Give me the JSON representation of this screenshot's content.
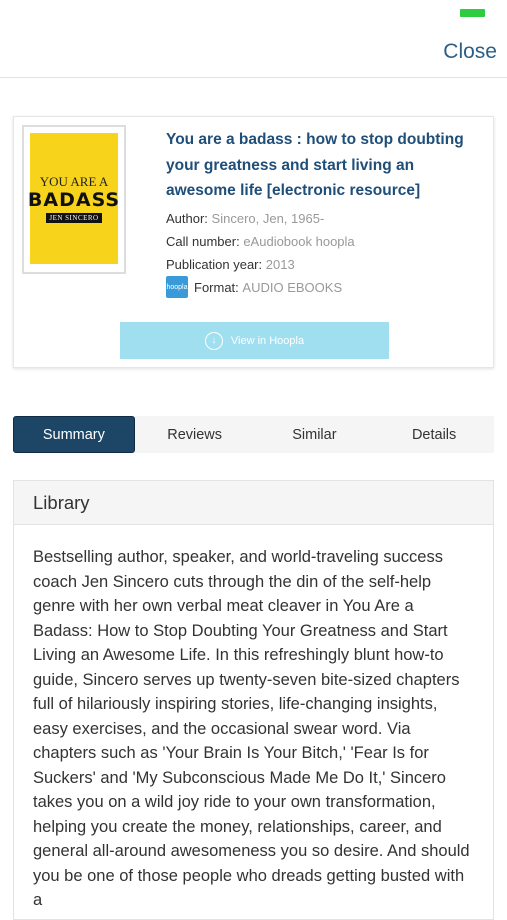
{
  "header": {
    "close_label": "Close",
    "battery_color": "#2ecc40"
  },
  "book": {
    "cover": {
      "line1": "YOU ARE A",
      "line2": "BADASS",
      "line3": "JEN SINCERO",
      "color": "#f7d31c"
    },
    "title": "You are a badass : how to stop doubting your greatness and start living an awesome life [electronic resource]",
    "author_label": "Author:",
    "author_value": "Sincero, Jen, 1965-",
    "call_label": "Call number:",
    "call_value": "eAudiobook hoopla",
    "pub_label": "Publication year:",
    "pub_value": "2013",
    "format_icon_text": "hoopla",
    "format_label": "Format:",
    "format_value": "AUDIO EBOOKS",
    "view_button_label": "View in Hoopla"
  },
  "tabs": [
    {
      "label": "Summary",
      "active": true
    },
    {
      "label": "Reviews",
      "active": false
    },
    {
      "label": "Similar",
      "active": false
    },
    {
      "label": "Details",
      "active": false
    }
  ],
  "panel": {
    "heading": "Library",
    "summary": "Bestselling author, speaker, and world-traveling success coach Jen Sincero cuts through the din of the self-help genre with her own verbal meat cleaver in You Are a Badass: How to Stop Doubting Your Greatness and Start Living an Awesome Life. In this refreshingly blunt how-to guide, Sincero serves up twenty-seven bite-sized chapters full of hilariously inspiring stories, life-changing insights, easy exercises, and the occasional swear word. Via chapters such as 'Your Brain Is Your Bitch,' 'Fear Is for Suckers' and 'My Subconscious Made Me Do It,' Sincero takes you on a wild joy ride to your own transformation, helping you create the money, relationships, career, and general all-around awesomeness you so desire. And should you be one of those people who dreads getting busted with a"
  },
  "colors": {
    "title": "#1f4e79",
    "active_tab": "#1c4566",
    "view_button": "#9fdff0"
  }
}
